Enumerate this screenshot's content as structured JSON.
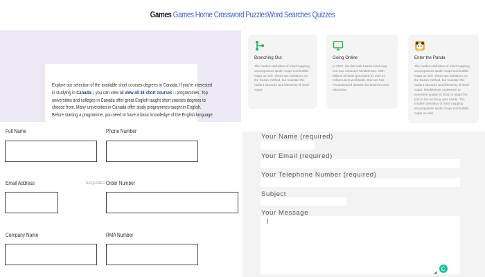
{
  "nav": {
    "brand": "Games",
    "links": [
      "Games",
      "Home",
      "Crossword Puzzles",
      "Word Searches",
      "Quizzes"
    ]
  },
  "intro": {
    "text_1": "Explore our selection of the available short courses degrees in Canada. If you're interested in studying in",
    "link_1": "Canada",
    "text_2": ", you can view all",
    "link_2": "view all 38 short courses",
    "text_3": "programmes. Top universities and colleges in Canada offer great English-taught short courses degrees to choose from. Many universities in Canada offer study programmes taught in English. Before starting a programme, you need to have a basic knowledge of the English language."
  },
  "left_form": {
    "full_name": "Full Name",
    "phone_number": "Phone Number",
    "email_address": "Email Address",
    "required": "REQUIRED",
    "order_number": "Order Number",
    "company_name": "Company Name",
    "rma_number": "RMA Number"
  },
  "cards": [
    {
      "icon": "branch-icon",
      "title": "Branching Out",
      "desc": "The modern definition of mind mapping encompasses spider maps and bubble maps as well. These are variations on the Buzan method, but maintain the radiant structure and hierarchy of mind maps."
    },
    {
      "icon": "monitor-icon",
      "title": "Going Online",
      "desc": "In 2007, the first web-based mind map tool was released: MindMeister. With billions of ideas generated by over 27 million users worldwide, this tool has revolutionized ideation for business and education."
    },
    {
      "icon": "panda-icon",
      "title": "Enter the Panda",
      "desc": "The modern definition of mind mapping encompasses spider maps and bubble maps as well. These are variations on the Buzan method, but maintain the radiant structure and hierarchy of mind maps. MindMeister underwent an extensive update in 2021 to adapt the tool to the evolving user needs. The modern definition of mind mapping encompasses spider maps and bubble maps as well."
    }
  ],
  "contact_form": {
    "name": "Your Name (required)",
    "email": "Your Email (required)",
    "phone": "Your Telephone Number (required)",
    "subject": "Subject",
    "message": "Your Message"
  },
  "colors": {
    "accent_green": "#21b35a",
    "link_blue": "#3b5bd6",
    "panel_lavender": "#ece8f4"
  }
}
